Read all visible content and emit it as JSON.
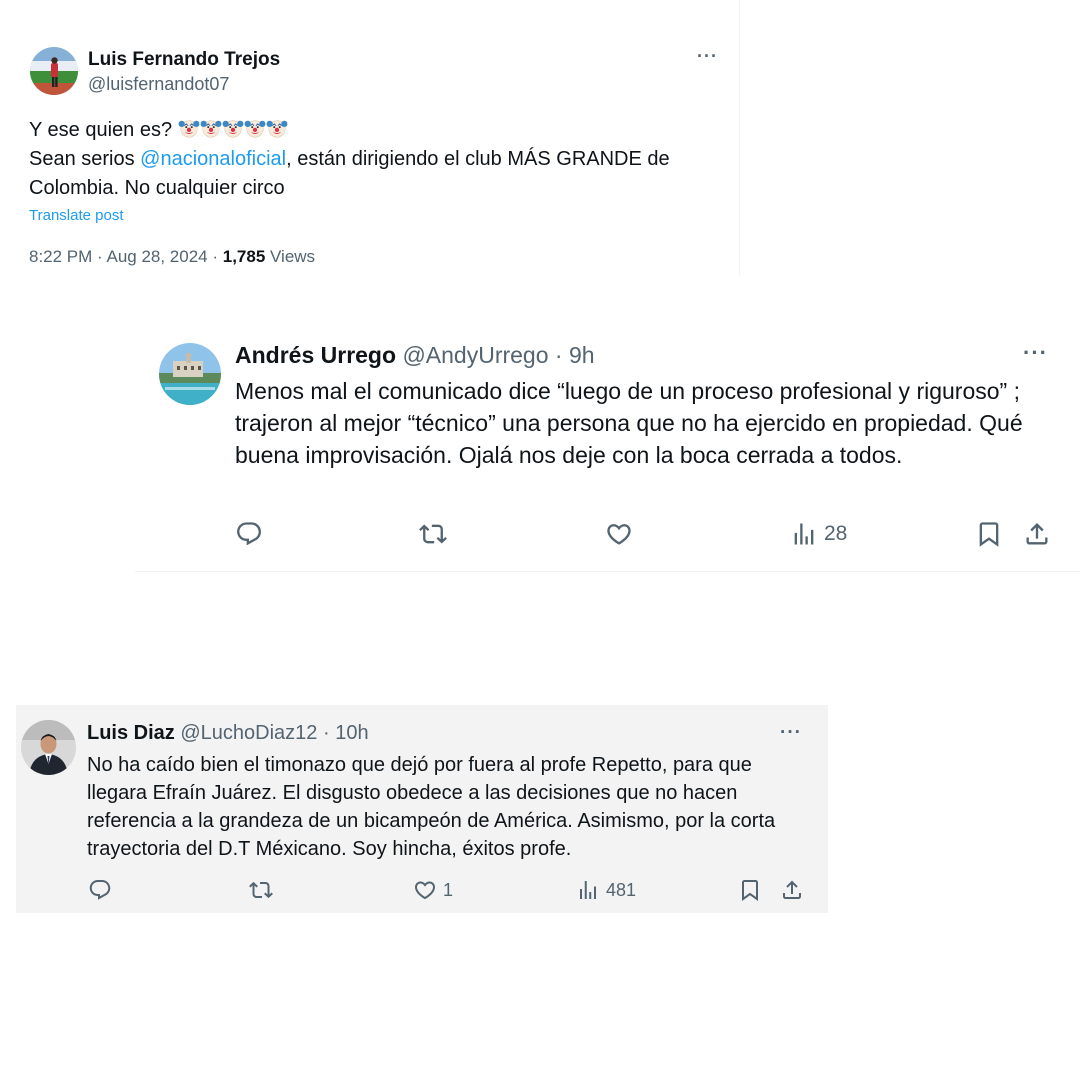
{
  "tweet_main": {
    "author_name": "Luis Fernando Trejos",
    "author_handle": "@luisfernandot07",
    "text_line1": "Y ese quien es?",
    "emoji": "🤡",
    "emoji_count": 5,
    "text_line2_pre": "Sean serios ",
    "mention": "@nacionaloficial",
    "text_line2_post": ", están dirigiendo el club MÁS GRANDE de Colombia. No cualquier circo",
    "translate_label": "Translate post",
    "timestamp": "8:22 PM · Aug 28, 2024 · ",
    "views_count": "1,785",
    "views_label": " Views",
    "more_glyph": "···"
  },
  "reply_1": {
    "author_name": "Andrés Urrego",
    "author_handle": "@AndyUrrego",
    "time": " · 9h",
    "text": "Menos mal el comunicado dice “luego de un proceso profesional y riguroso” ; trajeron al mejor “técnico” una persona que no ha ejercido en propiedad. Qué buena improvisación. Ojalá nos deje con la boca cerrada a todos.",
    "views_count": "28",
    "more_glyph": "···"
  },
  "reply_2": {
    "author_name": "Luis Diaz",
    "author_handle": "@LuchoDiaz12",
    "time": " · 10h",
    "text": "No ha caído bien el timonazo que dejó por fuera al profe Repetto, para que llegara Efraín Juárez. El disgusto obedece a las decisiones que no hacen referencia a la grandeza de un bicampeón de América. Asimismo, por la corta trayectoria del D.T Méxicano. Soy hincha, éxitos profe.",
    "likes_count": "1",
    "views_count": "481",
    "more_glyph": "···"
  },
  "icons": [
    "reply-icon",
    "repost-icon",
    "like-icon",
    "views-icon",
    "bookmark-icon",
    "share-icon"
  ],
  "colors": {
    "link": "#1d9bf0",
    "muted": "#536471",
    "text": "#0f1419",
    "reply_2_background": "#f3f3f3"
  }
}
